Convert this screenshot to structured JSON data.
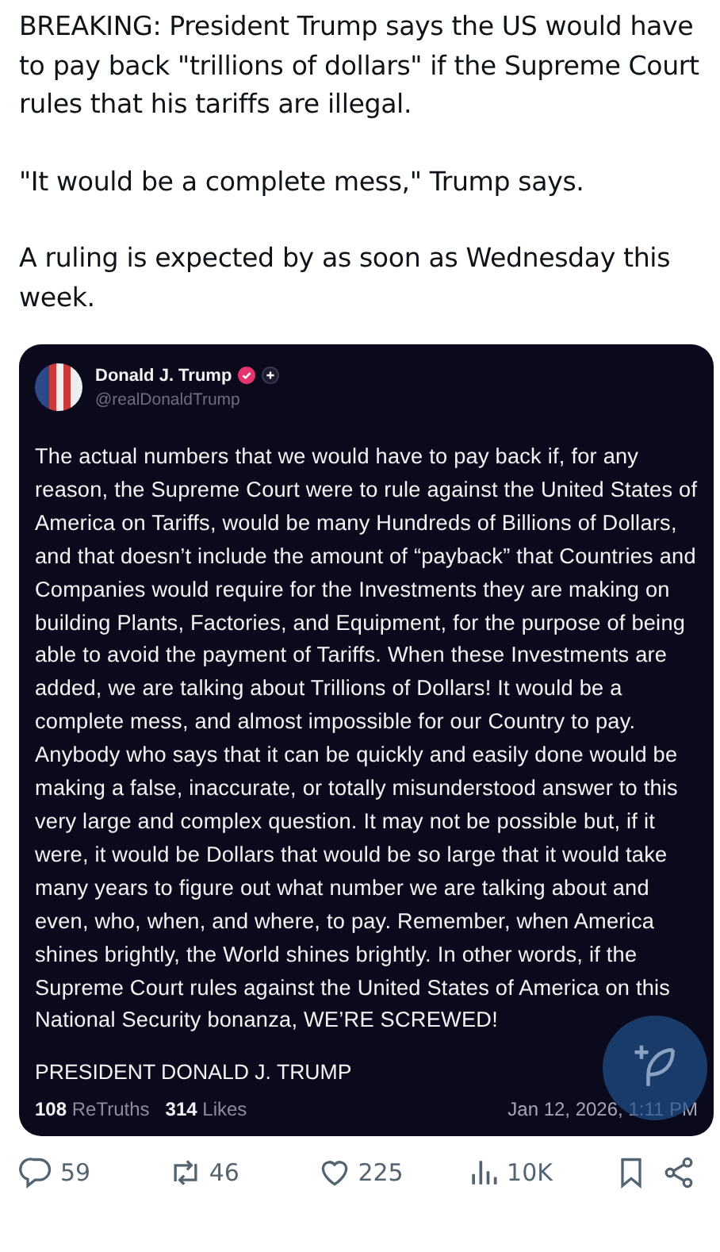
{
  "post": {
    "paragraphs": [
      "BREAKING: President Trump says the US would have to pay back \"trillions of dollars\" if the Supreme Court rules that his tariffs are illegal.",
      "\"It would be a complete mess,\" Trump says.",
      "A ruling is expected by as soon as Wednesday this week."
    ]
  },
  "embed": {
    "author": "Donald J. Trump",
    "handle": "@realDonaldTrump",
    "verified": true,
    "body": "The actual numbers that we would have to pay back if, for any reason, the Supreme Court were to rule against the United States of America on Tariffs, would be many Hundreds of Billions of Dollars, and that doesn’t include the amount of “payback” that Countries and Companies would require for the Investments they are making on building Plants, Factories, and Equipment, for the purpose of being able to avoid the payment of Tariffs. When these Investments are added, we are talking about Trillions of Dollars! It would be a complete mess, and almost impossible for our Country to pay. Anybody who says that it can be quickly and easily done would be making a false, inaccurate, or totally misunderstood answer to this very large and complex question. It may not be possible but, if it were, it would be Dollars that would be so large that it would take many years to figure out what number we are talking about and even, who, when, and where, to pay. Remember, when America shines brightly, the World shines brightly. In other words, if the Supreme Court rules against the United States of America on this National Security bonanza, WE’RE SCREWED!",
    "signature": "PRESIDENT DONALD J. TRUMP",
    "stats": [
      {
        "count": "108",
        "label": "ReTruths"
      },
      {
        "count": "314",
        "label": "Likes"
      }
    ],
    "timestamp": "Jan 12, 2026, 1:11 PM"
  },
  "actions": [
    {
      "kind": "reply",
      "count": "59"
    },
    {
      "kind": "repost",
      "count": "46"
    },
    {
      "kind": "like",
      "count": "225"
    },
    {
      "kind": "views",
      "count": "10K"
    },
    {
      "kind": "bookmark"
    },
    {
      "kind": "share"
    }
  ]
}
